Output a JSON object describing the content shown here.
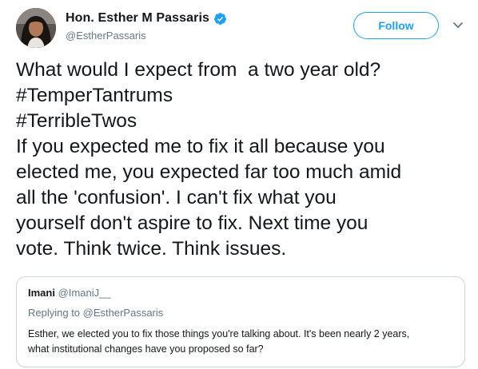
{
  "author": {
    "display_name": "Hon. Esther M Passaris",
    "handle": "@EstherPassaris",
    "verified": true,
    "avatar_icon": "profile-photo",
    "verified_icon": "verified-badge-icon"
  },
  "actions": {
    "follow_label": "Follow",
    "more_icon": "chevron-down-icon"
  },
  "tweet": {
    "lines": [
      "What would I expect from  a two year old?",
      "#TemperTantrums",
      "#TerribleTwos",
      "If you expected me to fix it all because you",
      "elected me, you expected far too much amid",
      "all the 'confusion'. I can't fix what you",
      "yourself don't aspire to fix. Next time you",
      "vote. Think twice. Think issues."
    ]
  },
  "quote": {
    "name": "Imani",
    "handle": "@ImaniJ__",
    "replying_to": "Replying to @EstherPassaris",
    "text_lines": [
      "Esther, we elected you to fix those things you're talking about. It's been nearly 2 years,",
      "what institutional changes have you proposed so far?"
    ]
  },
  "colors": {
    "accent": "#1da1f2",
    "text": "#14171a",
    "muted": "#657786",
    "border": "#ccd6dd"
  }
}
